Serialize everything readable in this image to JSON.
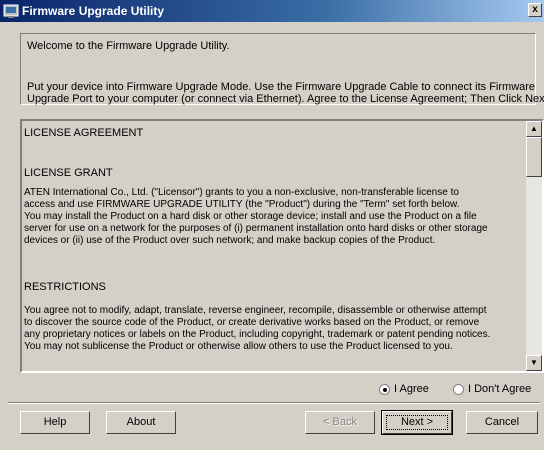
{
  "window": {
    "title": "Firmware Upgrade Utility",
    "close_glyph": "x",
    "titlebar_color": "#0a246a",
    "icon": "app-window-icon"
  },
  "welcome": {
    "greeting": "Welcome to the Firmware Upgrade Utility.",
    "instruction_line1": "Put your device into Firmware Upgrade Mode. Use the Firmware Upgrade Cable to connect its Firmware",
    "instruction_line2": "Upgrade Port to your computer (or connect via Ethernet). Agree to the License Agreement; Then Click Next."
  },
  "license": {
    "heading": "LICENSE AGREEMENT",
    "grant_heading": "LICENSE GRANT",
    "grant_lines": [
      "ATEN International Co., Ltd. (\"Licensor\") grants to you a non-exclusive, non-transferable license to",
      "access and use FIRMWARE UPGRADE UTILITY (the \"Product\") during the \"Term\" set forth below.",
      "You may install the Product on a hard disk or other storage device; install and use the Product on a file",
      "server for use on a network for the purposes of (i) permanent installation onto hard disks or other storage",
      "devices or (ii) use of the Product over such network; and make backup copies of the Product."
    ],
    "restrictions_heading": "RESTRICTIONS",
    "restrictions_lines": [
      "You agree not to modify, adapt, translate, reverse engineer, recompile, disassemble or otherwise attempt",
      "to discover the source code of the Product, or create derivative works based on the Product, or remove",
      "any proprietary notices or labels on the Product, including copyright, trademark or patent pending notices.",
      "You may not sublicense the Product or otherwise allow others to use the Product licensed to you."
    ]
  },
  "agreement": {
    "agree_label": "I Agree",
    "disagree_label": "I Don't Agree",
    "selected": "agree"
  },
  "buttons": {
    "help": "Help",
    "about": "About",
    "back": "< Back",
    "next": "Next >",
    "cancel": "Cancel"
  },
  "scrollbar": {
    "up_glyph": "▲",
    "down_glyph": "▼"
  }
}
